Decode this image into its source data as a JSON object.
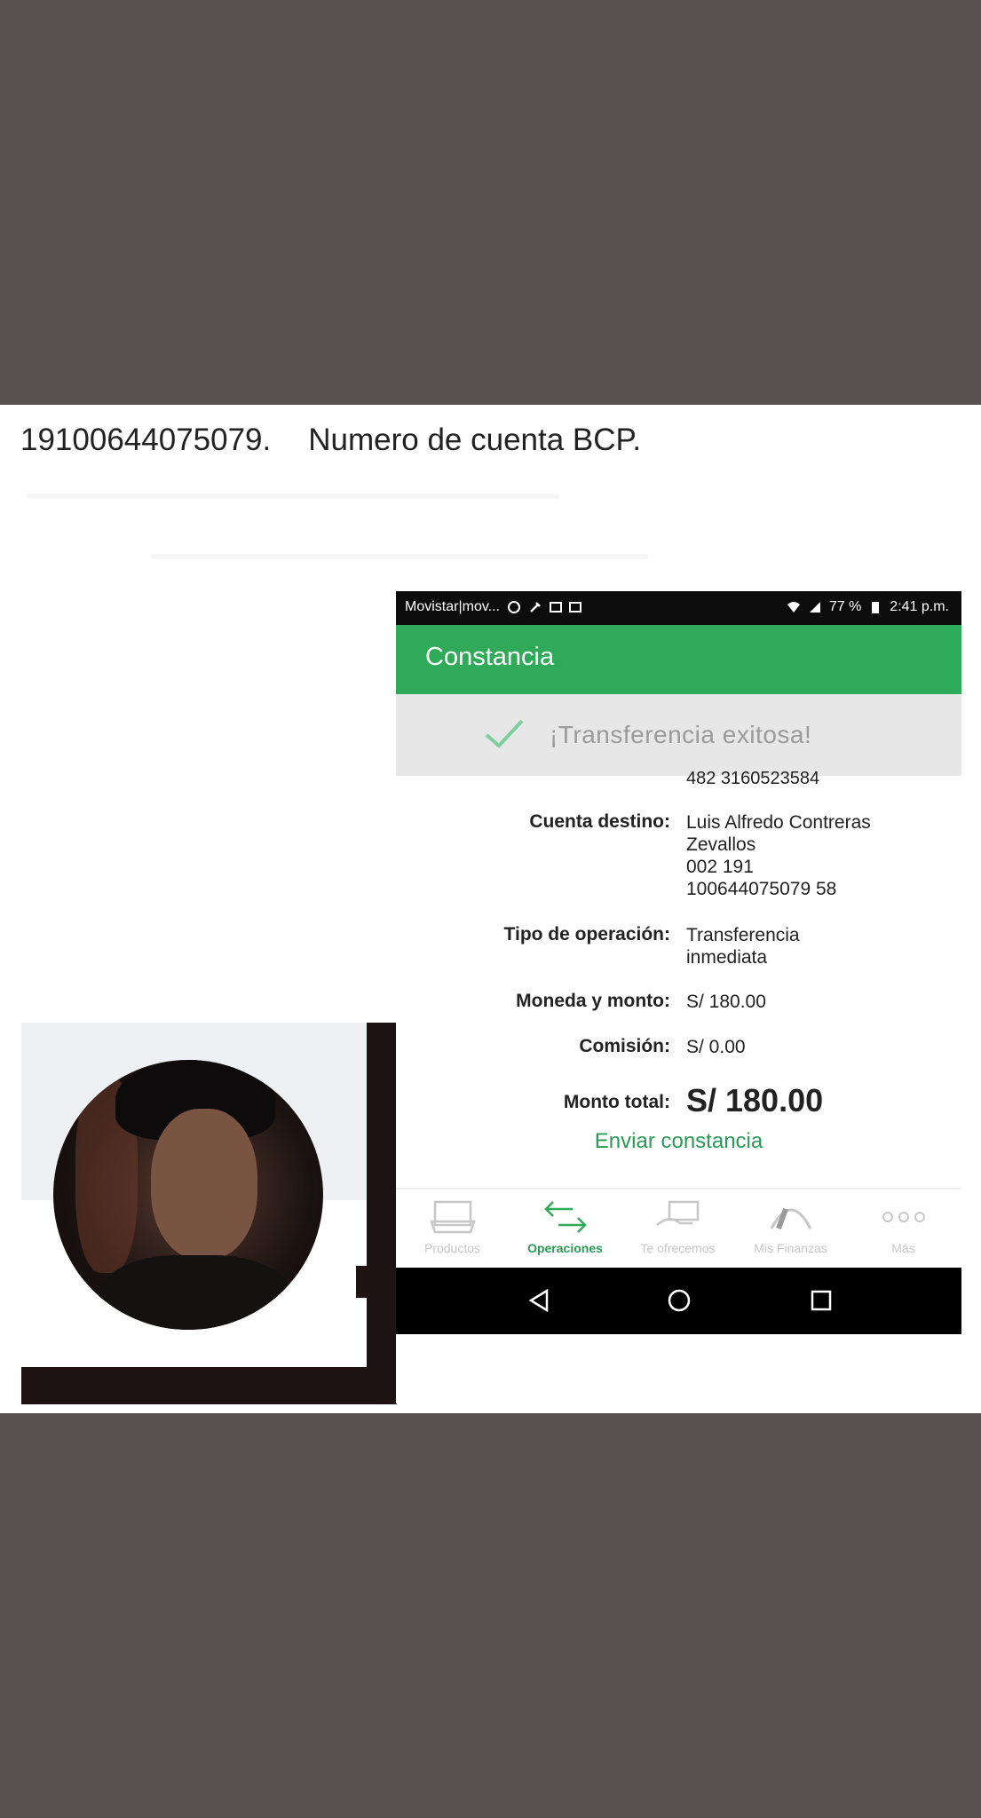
{
  "caption": {
    "account_number": "19100644075079.",
    "account_label": "Numero de cuenta BCP."
  },
  "status_bar": {
    "carrier": "Movistar|mov...",
    "battery": "77 %",
    "time": "2:41 p.m."
  },
  "app": {
    "title": "Constancia",
    "success_message": "¡Transferencia exitosa!",
    "accent_color": "#2eaa58"
  },
  "details": {
    "clipped_line": "482 3160523584",
    "rows": [
      {
        "label": "Cuenta destino:",
        "value": [
          "Luis Alfredo Contreras",
          "Zevallos",
          "002 191",
          "100644075079 58"
        ]
      },
      {
        "label": "Tipo de operación:",
        "value": [
          "Transferencia",
          "inmediata"
        ]
      },
      {
        "label": "Moneda y monto:",
        "value": [
          "S/ 180.00"
        ]
      },
      {
        "label": "Comisión:",
        "value": [
          "S/ 0.00"
        ]
      },
      {
        "label": "Monto total:",
        "value": [
          "S/ 180.00"
        ]
      }
    ],
    "send_action": "Enviar constancia"
  },
  "tabs": [
    {
      "label": "Productos",
      "icon": "wallet-icon",
      "active": false
    },
    {
      "label": "Operaciones",
      "icon": "transfer-arrows-icon",
      "active": true
    },
    {
      "label": "Te ofrecemos",
      "icon": "card-hand-icon",
      "active": false
    },
    {
      "label": "Mis Finanzas",
      "icon": "gauge-icon",
      "active": false
    },
    {
      "label": "Más",
      "icon": "more-dots-icon",
      "active": false
    }
  ],
  "system_nav": [
    "back-icon",
    "home-icon",
    "recents-icon"
  ]
}
